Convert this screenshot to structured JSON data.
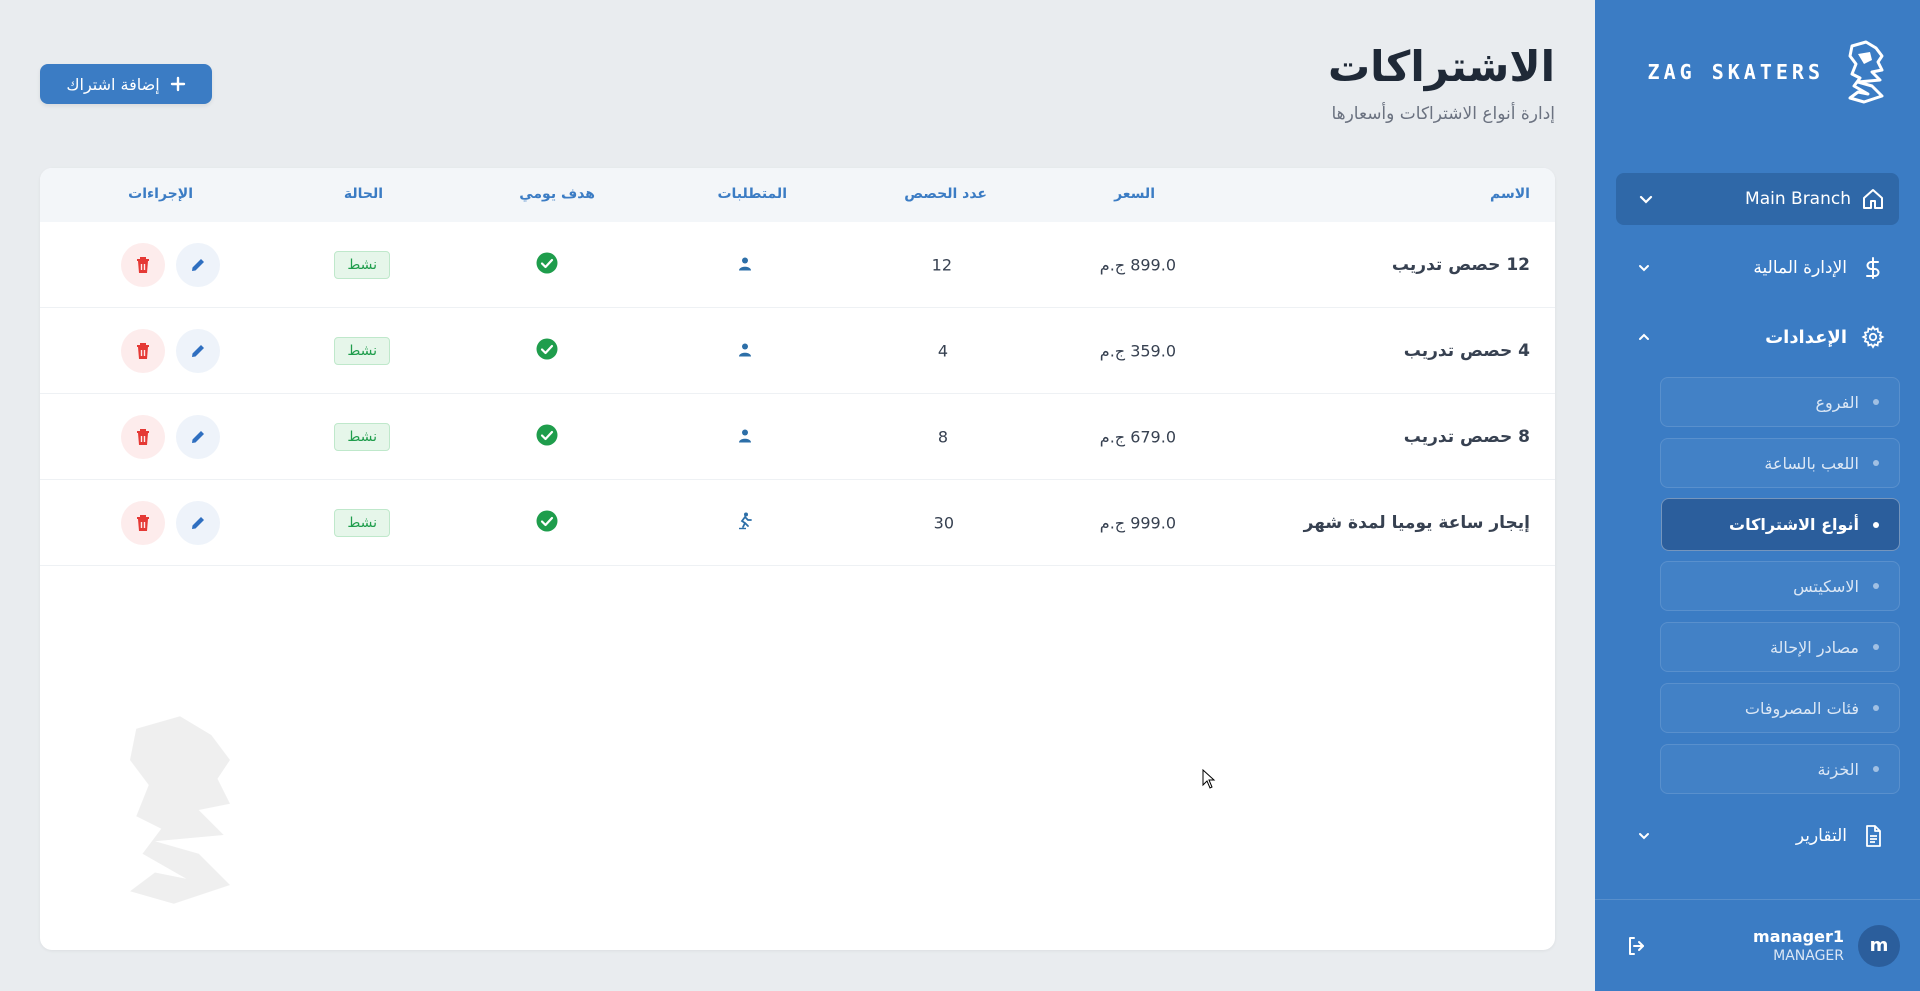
{
  "brand": {
    "name": "ZAG SKATERS"
  },
  "colors": {
    "primary": "#3b7cc4",
    "sidebar_dark": "#2f68a8",
    "success": "#1f9d4c",
    "danger": "#e53935"
  },
  "sidebar": {
    "branch": {
      "label": "Main Branch",
      "icon": "home-icon"
    },
    "finance": {
      "label": "الإدارة المالية",
      "icon": "dollar-icon"
    },
    "settings": {
      "label": "الإعدادات",
      "icon": "gear-icon"
    },
    "sub_items": [
      {
        "label": "الفروع",
        "active": false
      },
      {
        "label": "اللعب بالساعة",
        "active": false
      },
      {
        "label": "أنواع الاشتراكات",
        "active": true
      },
      {
        "label": "الاسكيتس",
        "active": false
      },
      {
        "label": "مصادر الإحالة",
        "active": false
      },
      {
        "label": "فئات المصروفات",
        "active": false
      },
      {
        "label": "الخزنة",
        "active": false
      }
    ],
    "reports": {
      "label": "التقارير",
      "icon": "document-icon"
    }
  },
  "user": {
    "avatar_letter": "m",
    "name": "manager1",
    "role": "MANAGER"
  },
  "page": {
    "title": "الاشتراكات",
    "subtitle": "إدارة أنواع الاشتراكات وأسعارها",
    "add_button": "إضافة اشتراك"
  },
  "table": {
    "headers": {
      "name": "الاسم",
      "price": "السعر",
      "sessions": "عدد الحصص",
      "requirements": "المتطلبات",
      "daily_goal": "هدف يومي",
      "status": "الحالة",
      "actions": "الإجراءات"
    },
    "rows": [
      {
        "name": "12 حصص تدريب",
        "price": "899.0 ج.م",
        "sessions": "12",
        "requirement_icon": "person-icon",
        "status": "نشط"
      },
      {
        "name": "4 حصص تدريب",
        "price": "359.0 ج.م",
        "sessions": "4",
        "requirement_icon": "person-icon",
        "status": "نشط"
      },
      {
        "name": "8 حصص تدريب",
        "price": "679.0 ج.م",
        "sessions": "8",
        "requirement_icon": "person-icon",
        "status": "نشط"
      },
      {
        "name": "إيجار ساعة يوميا لمدة شهر",
        "price": "999.0 ج.م",
        "sessions": "30",
        "requirement_icon": "skater-icon",
        "status": "نشط"
      }
    ]
  }
}
